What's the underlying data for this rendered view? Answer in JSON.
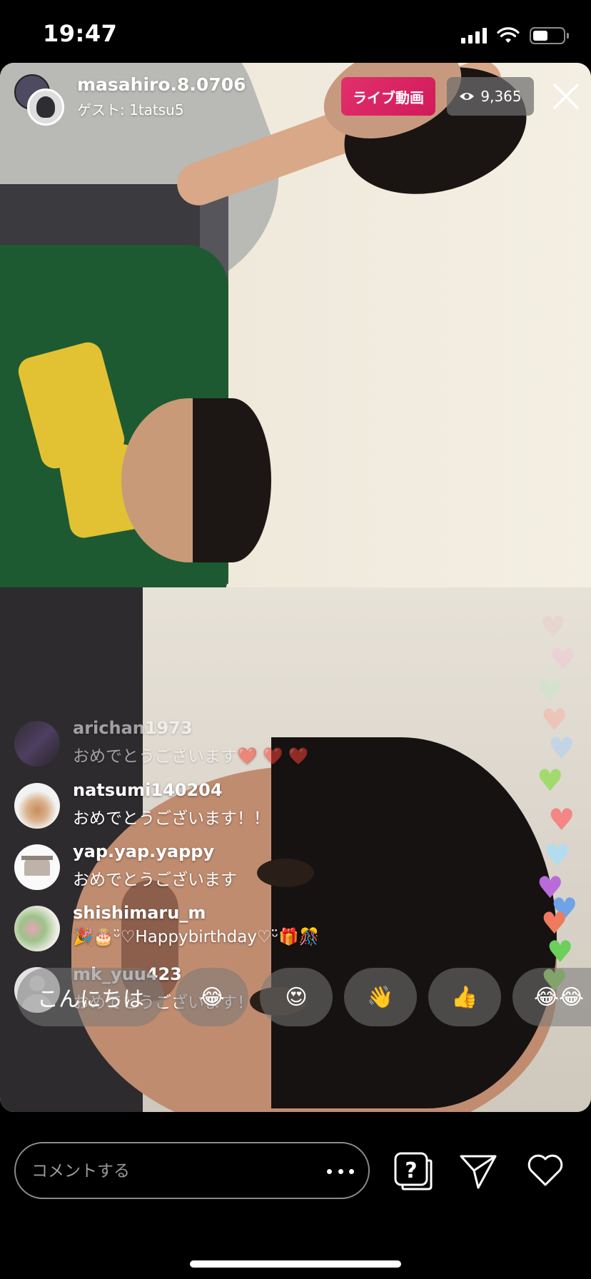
{
  "status_bar": {
    "time": "19:47"
  },
  "header": {
    "host_username": "masahiro.8.0706",
    "guest_label": "ゲスト: 1tatsu5",
    "live_badge": "ライブ動画",
    "viewer_count": "9,365"
  },
  "comments": [
    {
      "username": "arichan1973",
      "text": "おめでとうございます❤️ ❤️ ❤️"
    },
    {
      "username": "natsumi140204",
      "text": "おめでとうございます！！"
    },
    {
      "username": "yap.yap.yappy",
      "text": "おめでとうございます"
    },
    {
      "username": "shishimaru_m",
      "text": "🎉🎂ᵕ̈♡Happybirthday♡ᵕ̈🎁🎊"
    },
    {
      "username": "mk_yuu423",
      "text": "おめでとうございます！"
    }
  ],
  "quick_replies": [
    "こんにちは",
    "😂",
    "😍",
    "👋",
    "👍",
    "😂😂"
  ],
  "comment_input": {
    "placeholder": "コメントする"
  },
  "icons": {
    "host": "host-avatar",
    "viewers": "eye-icon",
    "close": "close-icon",
    "more": "more-options-icon",
    "question": "question-sticker-icon",
    "send": "send-paper-plane-icon",
    "like": "heart-outline-icon"
  },
  "colors": {
    "live_badge": "#e1306c",
    "background": "#000000"
  }
}
